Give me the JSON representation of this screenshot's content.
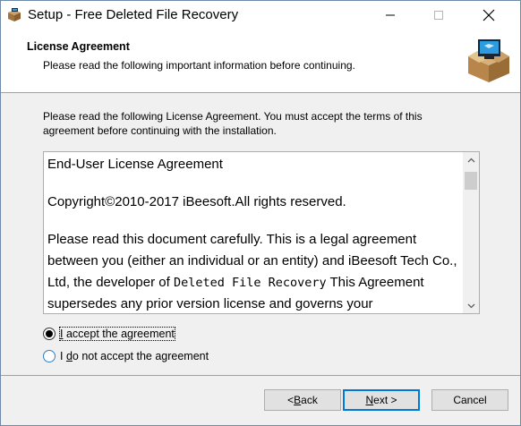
{
  "window": {
    "title": "Setup - Free Deleted File Recovery"
  },
  "header": {
    "title": "License Agreement",
    "subtitle": "Please read the following important information before continuing."
  },
  "intro": "Please read the following License Agreement. You must accept the terms of this agreement before continuing with the installation.",
  "license": {
    "line1": "End-User License Agreement",
    "line2": "Copyright©2010-2017 iBeesoft.All rights reserved.",
    "p3_a": "Please read this document carefully. This is a legal agreement between you (either an individual or an entity) and iBeesoft Tech Co., Ltd, the developer of ",
    "p3_product": "Deleted File Recovery",
    "p3_b": " This Agreement supersedes any prior version license and governs your"
  },
  "options": {
    "accept_pre": "I",
    "accept_rest": " accept the agreement",
    "decline_pre": "I ",
    "decline_key": "d",
    "decline_rest": "o not accept the agreement",
    "selected": "accept"
  },
  "buttons": {
    "back_pre": "< ",
    "back_key": "B",
    "back_rest": "ack",
    "next_pre": "",
    "next_key": "N",
    "next_rest": "ext >",
    "cancel": "Cancel"
  },
  "colors": {
    "focus_blue": "#0078d7",
    "header_bg": "#ffffff",
    "dialog_bg": "#f0f0f0"
  },
  "icons": [
    "installer-box-icon",
    "minimize-icon",
    "maximize-icon",
    "close-icon",
    "scroll-up-icon",
    "scroll-down-icon"
  ]
}
